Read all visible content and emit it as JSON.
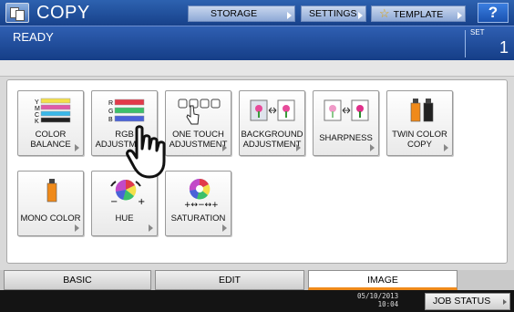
{
  "header": {
    "title": "COPY",
    "buttons": [
      "STORAGE",
      "SETTINGS",
      "TEMPLATE"
    ],
    "help_label": "?"
  },
  "status": {
    "message": "READY",
    "set_label": "SET",
    "set_value": "1"
  },
  "functions": [
    {
      "line1": "COLOR",
      "line2": "BALANCE",
      "icon": "color-balance-icon"
    },
    {
      "line1": "RGB",
      "line2": "ADJUSTMENT",
      "icon": "rgb-adjustment-icon"
    },
    {
      "line1": "ONE TOUCH",
      "line2": "ADJUSTMENT",
      "icon": "one-touch-icon"
    },
    {
      "line1": "BACKGROUND",
      "line2": "ADJUSTMENT",
      "icon": "background-icon"
    },
    {
      "line1": "SHARPNESS",
      "line2": "",
      "icon": "sharpness-icon"
    },
    {
      "line1": "TWIN COLOR",
      "line2": "COPY",
      "icon": "twin-color-icon"
    },
    {
      "line1": "MONO COLOR",
      "line2": "",
      "icon": "mono-color-icon"
    },
    {
      "line1": "HUE",
      "line2": "",
      "icon": "hue-icon"
    },
    {
      "line1": "SATURATION",
      "line2": "",
      "icon": "saturation-icon"
    }
  ],
  "color_balance_letters": [
    "Y",
    "M",
    "C",
    "K"
  ],
  "rgb_letters": [
    "R",
    "G",
    "B"
  ],
  "tabs": [
    "BASIC",
    "EDIT",
    "IMAGE"
  ],
  "active_tab": "IMAGE",
  "footer": {
    "date": "05/10/2013",
    "time": "10:04",
    "job_status": "JOB STATUS"
  },
  "colors": {
    "header_blue": "#17418a",
    "active_tab_accent": "#f08a1a"
  }
}
